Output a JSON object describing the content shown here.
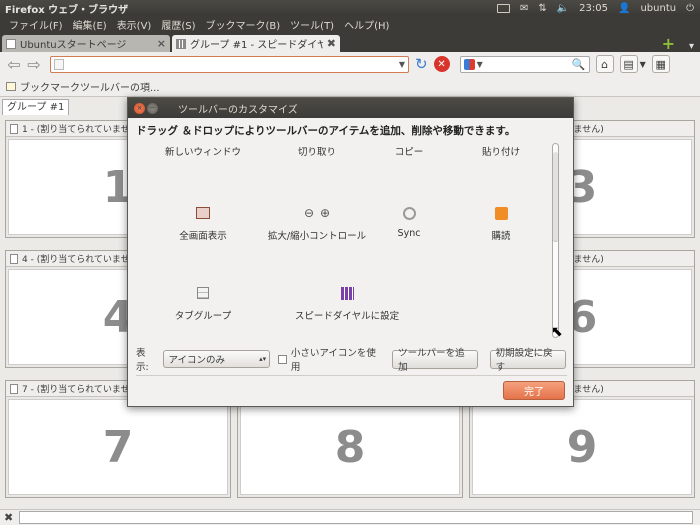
{
  "panel": {
    "app_title": "Firefox ウェブ・ブラウザ",
    "clock": "23:05",
    "user": "ubuntu"
  },
  "menubar": [
    {
      "label": "ファイル(F)"
    },
    {
      "label": "編集(E)"
    },
    {
      "label": "表示(V)"
    },
    {
      "label": "履歴(S)"
    },
    {
      "label": "ブックマーク(B)"
    },
    {
      "label": "ツール(T)"
    },
    {
      "label": "ヘルプ(H)"
    }
  ],
  "tabs": [
    {
      "label": "Ubuntuスタートページ",
      "active": false
    },
    {
      "label": "グループ #1 - スピードダイヤル",
      "active": true
    }
  ],
  "navbar": {
    "url_value": "",
    "search_value": ""
  },
  "bookmarks": {
    "item": "ブックマークツールバーの項..."
  },
  "content": {
    "group_tab": "グループ #1",
    "dials": [
      {
        "header": "1 - (割り当てられていませ",
        "number": "1"
      },
      {
        "header": "(ません)",
        "number": "3"
      },
      {
        "header": "4 - (割り当てられていませ",
        "number": "4"
      },
      {
        "header": "(ません)",
        "number": "6"
      },
      {
        "header": "7 - (割り当てられていませ",
        "number": "7"
      },
      {
        "header": "",
        "number": "8"
      },
      {
        "header": "(ません)",
        "number": "9"
      }
    ]
  },
  "dialog": {
    "title": "ツールバーのカスタマイズ",
    "instructions": "ドラッグ ＆ドロップによりツールバーのアイテムを追加、削除や移動できます。",
    "palette": [
      {
        "label": "新しいウィンドウ",
        "icon": "new-window-icon"
      },
      {
        "label": "切り取り",
        "icon": "cut-icon"
      },
      {
        "label": "コピー",
        "icon": "copy-icon"
      },
      {
        "label": "貼り付け",
        "icon": "paste-icon"
      },
      {
        "label": "全画面表示",
        "icon": "fullscreen-icon"
      },
      {
        "label": "拡大/縮小コントロール",
        "icon": "zoom-icon"
      },
      {
        "label": "Sync",
        "icon": "sync-icon"
      },
      {
        "label": "購読",
        "icon": "rss-icon"
      },
      {
        "label": "タブグループ",
        "icon": "tab-groups-icon"
      },
      {
        "label": "スピードダイヤルに設定",
        "icon": "speed-dial-icon"
      }
    ],
    "show_label": "表示:",
    "show_value": "アイコンのみ",
    "small_icons_label": "小さいアイコンを使用",
    "add_toolbar": "ツールバーを追加",
    "reset": "初期設定に戻す",
    "done": "完了"
  },
  "colors": {
    "panel": "#3c3b37",
    "accent": "#e4734a",
    "urlbar_border": "#d27c54"
  }
}
